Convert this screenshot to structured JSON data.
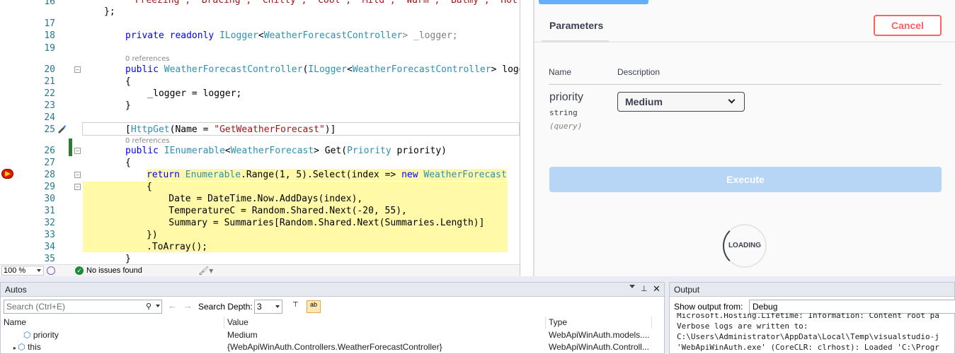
{
  "editor": {
    "line_numbers": [
      "16",
      "17",
      "18",
      "19",
      "20",
      "21",
      "22",
      "23",
      "24",
      "25",
      "26",
      "27",
      "28",
      "29",
      "30",
      "31",
      "32",
      "33",
      "34",
      "35"
    ],
    "top_line_text": "\"Freezing\", \"Bracing\", \"Chilly\", \"Cool\", \"Mild\", \"Warm\", \"Balmy\", \"Hot\", \"",
    "line16": "};",
    "line18_kw": "private readonly ",
    "line18_type": "ILogger",
    "line18_lt": "<",
    "line18_type2": "WeatherForecastController",
    "line18_rest": "> _logger;",
    "refs_1": "0 references",
    "line20_kw": "public ",
    "line20_type": "WeatherForecastController",
    "line20_p1": "(",
    "line20_type2": "ILogger",
    "line20_lt": "<",
    "line20_type3": "WeatherForecastController",
    "line20_rest": "> logge",
    "line21": "{",
    "line22": "    _logger = logger;",
    "line23": "}",
    "line25_open": "[",
    "line25_type": "HttpGet",
    "line25_mid": "(Name = ",
    "line25_str": "\"GetWeatherForecast\"",
    "line25_close": ")]",
    "refs_2": "0 references",
    "line26_kw": "public ",
    "line26_type": "IEnumerable",
    "line26_lt": "<",
    "line26_type2": "WeatherForecast",
    "line26_mid": "> Get(",
    "line26_type3": "Priority",
    "line26_rest": " priority)",
    "line27": "{",
    "line28_kw": "return ",
    "line28_type": "Enumerable",
    "line28_mid": ".Range(1, 5).Select(index => ",
    "line28_kw2": "new ",
    "line28_type2": "WeatherForecast",
    "line29": "{",
    "line30": "    Date = DateTime.Now.AddDays(index),",
    "line31": "    TemperatureC = Random.Shared.Next(-20, 55),",
    "line32": "    Summary = Summaries[Random.Shared.Next(Summaries.Length)]",
    "line33": "})",
    "line34": ".ToArray();",
    "line35": "}"
  },
  "status_bar": {
    "zoom": "100 %",
    "issues": "No issues found"
  },
  "swagger": {
    "tab_parameters": "Parameters",
    "cancel_label": "Cancel",
    "col_name": "Name",
    "col_description": "Description",
    "param_name": "priority",
    "param_type": "string",
    "param_in": "(query)",
    "param_value": "Medium",
    "execute_label": "Execute",
    "loading_label": "LOADING"
  },
  "autos": {
    "title": "Autos",
    "search_placeholder": "Search (Ctrl+E)",
    "search_depth_label": "Search Depth:",
    "search_depth_value": "3",
    "columns": [
      "Name",
      "Value",
      "Type"
    ],
    "rows": [
      {
        "name": "priority",
        "value": "Medium",
        "type": "WebApiWinAuth.models...."
      },
      {
        "name": "this",
        "value": "{WebApiWinAuth.Controllers.WeatherForecastController}",
        "type": "WebApiWinAuth.Controll..."
      }
    ]
  },
  "output": {
    "title": "Output",
    "show_from_label": "Show output from:",
    "source": "Debug",
    "lines": [
      "Microsoft.Hosting.Lifetime: Information: Content root pa",
      "Verbose logs are written to:",
      "C:\\Users\\Administrator\\AppData\\Local\\Temp\\visualstudio-j",
      "'WebApiWinAuth.exe' (CoreCLR: clrhost): Loaded 'C:\\Progr"
    ]
  },
  "colors": {
    "accent_blue": "#61affe",
    "cancel_red": "#ff6060",
    "highlight_yellow": "#fff9a8",
    "breakpoint_red": "#e51400"
  }
}
